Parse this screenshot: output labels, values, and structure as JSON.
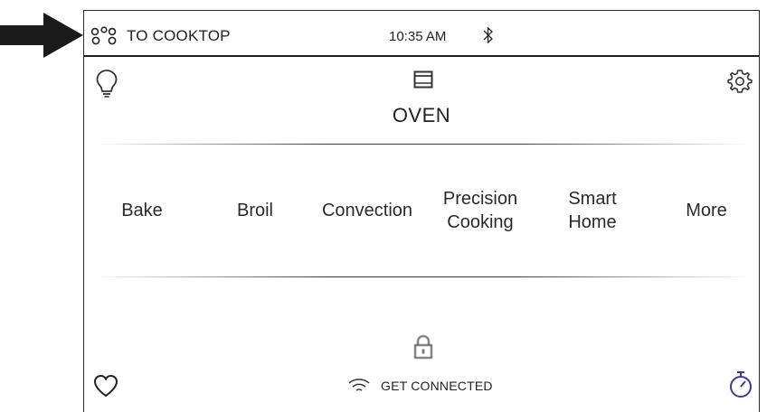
{
  "header": {
    "cooktop_label": "TO COOKTOP",
    "time": "10:35 AM"
  },
  "main": {
    "title": "OVEN",
    "modes": [
      {
        "label": "Bake"
      },
      {
        "label": "Broil"
      },
      {
        "label": "Convection"
      },
      {
        "label": "Precision\nCooking"
      },
      {
        "label": "Smart\nHome"
      },
      {
        "label": "More"
      }
    ]
  },
  "footer": {
    "connect_label": "GET CONNECTED"
  },
  "icons": {
    "arrow": "arrow-right-icon",
    "cooktop": "burners-icon",
    "bluetooth": "bluetooth-icon",
    "light": "lightbulb-icon",
    "oven": "oven-icon",
    "settings": "gear-icon",
    "lock": "lock-icon",
    "favorite": "heart-icon",
    "wifi": "wifi-icon",
    "timer": "timer-icon"
  },
  "colors": {
    "timer_accent": "#3a3a9a"
  }
}
